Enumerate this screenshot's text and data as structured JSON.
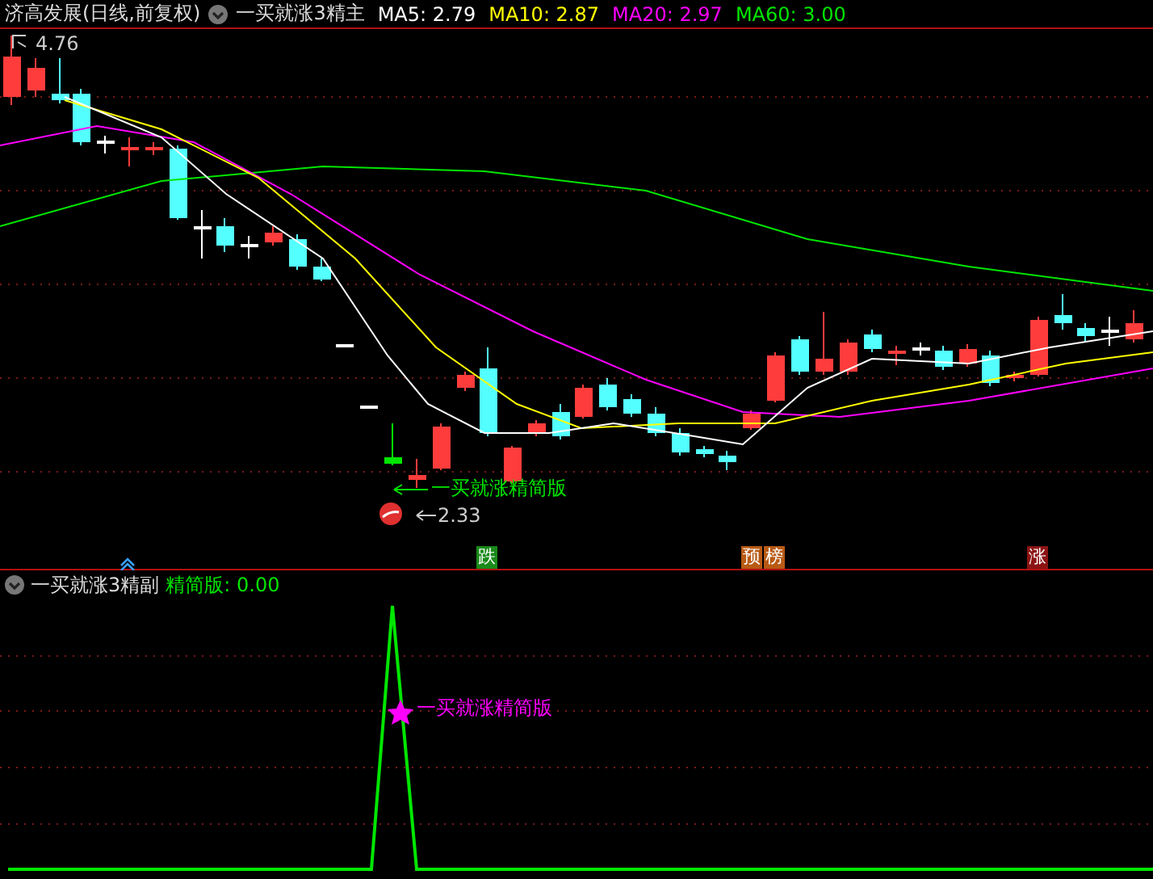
{
  "header": {
    "title": "济高发展(日线,前复权)",
    "indicator": "一买就涨3精主",
    "ma": [
      {
        "label": "MA5: 2.79",
        "color": "#ffffff"
      },
      {
        "label": "MA10: 2.87",
        "color": "#ffff00"
      },
      {
        "label": "MA20: 2.97",
        "color": "#ff00ff"
      },
      {
        "label": "MA60: 3.00",
        "color": "#00e600"
      }
    ]
  },
  "main_chart": {
    "high_label": "4.76",
    "low_label": "2.33",
    "signal_label": "一买就涨精简版"
  },
  "markers": [
    {
      "text": "跌",
      "color": "#1a8a1a"
    },
    {
      "text": "预",
      "color": "#b85a14"
    },
    {
      "text": "榜",
      "color": "#b85a14"
    },
    {
      "text": "涨",
      "color": "#8c1414"
    }
  ],
  "sub_panel": {
    "indicator": "一买就涨3精副",
    "reading": "精简版: 0.00",
    "signal_label": "一买就涨精简版"
  }
}
